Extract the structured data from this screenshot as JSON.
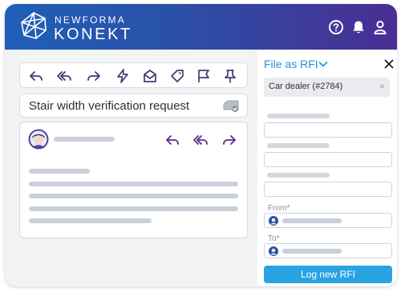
{
  "brand": {
    "line1": "NEWFORMA",
    "line2": "KONEKT"
  },
  "header_icons": [
    "help-icon",
    "bell-icon",
    "user-icon"
  ],
  "toolbar": [
    "reply-icon",
    "reply-all-icon",
    "forward-icon",
    "quick-action-icon",
    "open-envelope-icon",
    "tag-icon",
    "flag-icon",
    "pin-icon"
  ],
  "mail": {
    "subject": "Stair width verification request",
    "actions": [
      "reply-icon",
      "reply-all-icon",
      "forward-icon"
    ]
  },
  "rfi_panel": {
    "title": "File as RFI",
    "project_chip": "Car dealer (#2784)",
    "from_label": "From",
    "to_label": "To",
    "required_marker": "*",
    "submit_label": "Log new RFI"
  },
  "colors": {
    "header_start": "#1f5fb8",
    "header_end": "#4a2d93",
    "accent": "#2492d8",
    "icon_purple": "#5a2d8a",
    "button": "#2aa3e2"
  }
}
